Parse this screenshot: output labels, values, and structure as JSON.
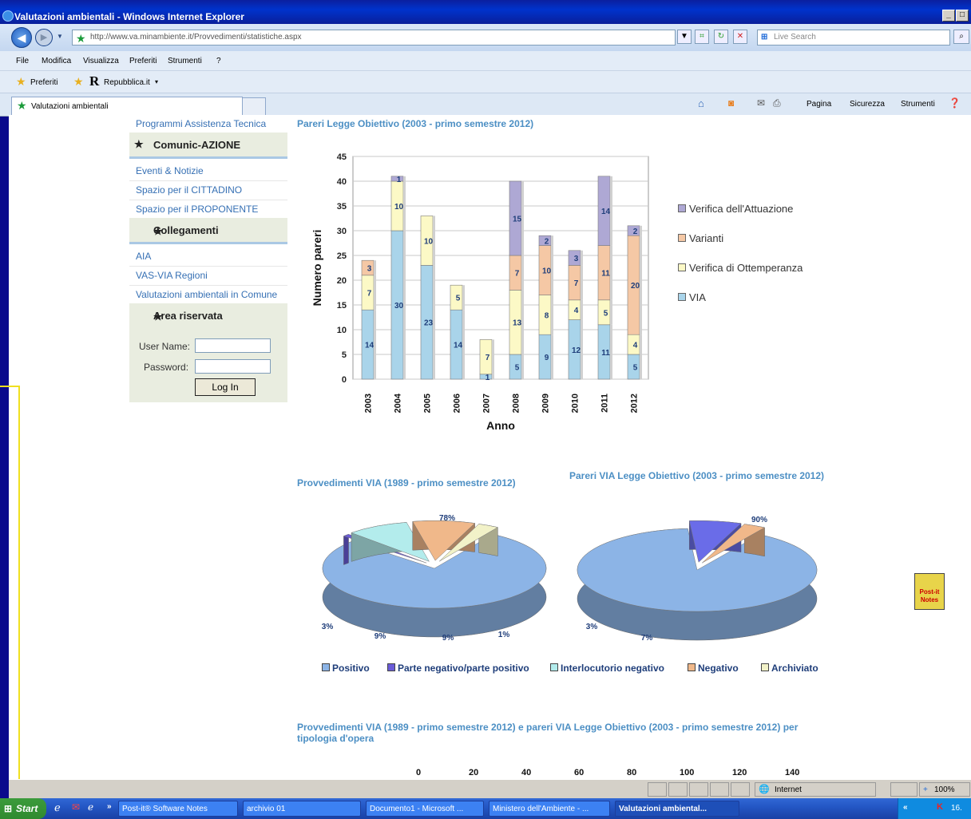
{
  "window": {
    "title": "Valutazioni ambientali - Windows Internet Explorer"
  },
  "address": {
    "url": "http://www.va.minambiente.it/Provvedimenti/statistiche.aspx",
    "search_placeholder": "Live Search"
  },
  "menu": [
    "File",
    "Modifica",
    "Visualizza",
    "Preferiti",
    "Strumenti",
    "?"
  ],
  "favbar": {
    "favorites": "Preferiti",
    "link": "Repubblica.it"
  },
  "tab": {
    "label": "Valutazioni ambientali"
  },
  "commands": [
    "Pagina",
    "Sicurezza",
    "Strumenti"
  ],
  "sidebar": {
    "top_link": "Programmi Assistenza Tecnica",
    "sections": [
      {
        "title": "Comunic-AZIONE",
        "links": [
          "Eventi & Notizie",
          "Spazio per il CITTADINO",
          "Spazio per il PROPONENTE"
        ]
      },
      {
        "title": "Collegamenti",
        "links": [
          "AIA",
          "VAS-VIA Regioni",
          "Valutazioni ambientali in Comune"
        ]
      },
      {
        "title": "Area riservata"
      }
    ],
    "login": {
      "user_label": "User Name:",
      "pass_label": "Password:",
      "button": "Log In"
    }
  },
  "chart_data": [
    {
      "type": "bar",
      "stacked": true,
      "title": "Pareri Legge Obiettivo (2003 - primo semestre 2012)",
      "xlabel": "Anno",
      "ylabel": "Numero pareri",
      "ylim": [
        0,
        45
      ],
      "yticks": [
        0,
        5,
        10,
        15,
        20,
        25,
        30,
        35,
        40,
        45
      ],
      "categories": [
        "2003",
        "2004",
        "2005",
        "2006",
        "2007",
        "2008",
        "2009",
        "2010",
        "2011",
        "2012"
      ],
      "series": [
        {
          "name": "VIA",
          "color": "#a9d4ea",
          "values": [
            14,
            30,
            23,
            14,
            1,
            5,
            9,
            12,
            11,
            5
          ]
        },
        {
          "name": "Verifica di Ottemperanza",
          "color": "#fcf9c6",
          "values": [
            7,
            10,
            10,
            5,
            7,
            13,
            8,
            4,
            5,
            4
          ]
        },
        {
          "name": "Varianti",
          "color": "#f5c8a5",
          "values": [
            3,
            0,
            0,
            0,
            0,
            7,
            10,
            7,
            11,
            20
          ]
        },
        {
          "name": "Verifica dell'Attuazione",
          "color": "#aea8d4",
          "values": [
            0,
            1,
            0,
            0,
            0,
            15,
            2,
            3,
            14,
            2
          ]
        }
      ],
      "legend_order": [
        "Verifica dell'Attuazione",
        "Varianti",
        "Verifica di Ottemperanza",
        "VIA"
      ],
      "legend_position": "right"
    },
    {
      "type": "pie",
      "title": "Provvedimenti VIA (1989 - primo semestre 2012)",
      "labels": [
        "Positivo",
        "Parte negativo/parte positivo",
        "Interlocutorio negativo",
        "Negativo",
        "Archiviato"
      ],
      "values": [
        78,
        1,
        9,
        9,
        3
      ],
      "display": [
        "78%",
        "1%",
        "9%",
        "9%",
        "3%"
      ],
      "colors": [
        "#8cb4e6",
        "#6a5cd8",
        "#b3ecec",
        "#f0b88a",
        "#f2f2c8"
      ]
    },
    {
      "type": "pie",
      "title": "Pareri VIA Legge Obiettivo (2003 - primo semestre 2012)",
      "labels": [
        "Positivo",
        "Parte negativo/parte positivo",
        "Negativo"
      ],
      "values": [
        90,
        7,
        3
      ],
      "display": [
        "90%",
        "7%",
        "3%"
      ],
      "colors": [
        "#8cb4e6",
        "#6a6ce8",
        "#f0b88a"
      ]
    }
  ],
  "pie_legend": [
    "Positivo",
    "Parte negativo/parte positivo",
    "Interlocutorio negativo",
    "Negativo",
    "Archiviato"
  ],
  "pie_legend_colors": [
    "#8cb4e6",
    "#6a5cd8",
    "#b3ecec",
    "#f0b88a",
    "#f2f2c8"
  ],
  "bottom_chart": {
    "title": "Provvedimenti VIA (1989 - primo semestre 2012) e pareri VIA Legge Obiettivo (2003 - primo semestre 2012) per tipologia d'opera",
    "xticks": [
      "0",
      "20",
      "40",
      "60",
      "80",
      "100",
      "120",
      "140"
    ]
  },
  "postit": {
    "label": "Post-it Notes"
  },
  "status": {
    "zone": "Internet",
    "zoom": "100%"
  },
  "taskbar": {
    "start": "Start",
    "items": [
      "Post-it® Software Notes",
      "archivio 01",
      "Documento1 - Microsoft ...",
      "Ministero dell'Ambiente - ...",
      "Valutazioni ambiental..."
    ],
    "clock": "16."
  }
}
